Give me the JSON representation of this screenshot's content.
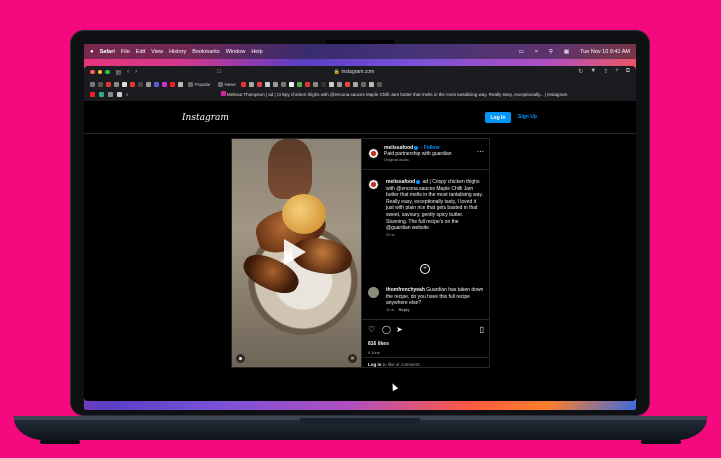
{
  "menubar": {
    "app": "Safari",
    "items": [
      "File",
      "Edit",
      "View",
      "History",
      "Bookmarks",
      "Window",
      "Help"
    ],
    "clock": "Tue Nov 10  9:41 AM"
  },
  "browser": {
    "address": "instagram.com",
    "bookmarks": [
      "Popular",
      "News"
    ],
    "tab_title": "Melissa Thompson | ad | Crispy chicken thighs with @encona.sauces Maple Chilli Jam butter that melts in the most tantalising way. Really easy, exceptionally... | Instagram"
  },
  "header": {
    "logo": "Instagram",
    "login_label": "Log In",
    "signup_label": "Sign Up"
  },
  "post": {
    "username": "melissafood",
    "follow_label": "Follow",
    "subtitle": "Paid partnership with guardian",
    "audio": "Original audio",
    "caption": "ad | Crispy chicken thighs with @encona.sauces Maple Chilli Jam butter that melts in the most tantalising way. Really easy, exceptionally tasty, I loved it just with plain rice that gets basted in that sweet, savoury, gently spicy butter. Stunning. The full recipe's on the @guardian website",
    "caption_time": "22 w",
    "comment_user": "thomfrenchyeah",
    "comment_text": "Guardian has taken down the recipe, do you have this full recipe anywhere else?",
    "comment_time": "11 w",
    "reply_label": "Reply",
    "likes": "816 likes",
    "date": "9 June",
    "login_prompt_link": "Log in",
    "login_prompt_rest": "to like or comment."
  },
  "colors": {
    "accent": "#0095f6",
    "background_frame": "#f5097f"
  }
}
